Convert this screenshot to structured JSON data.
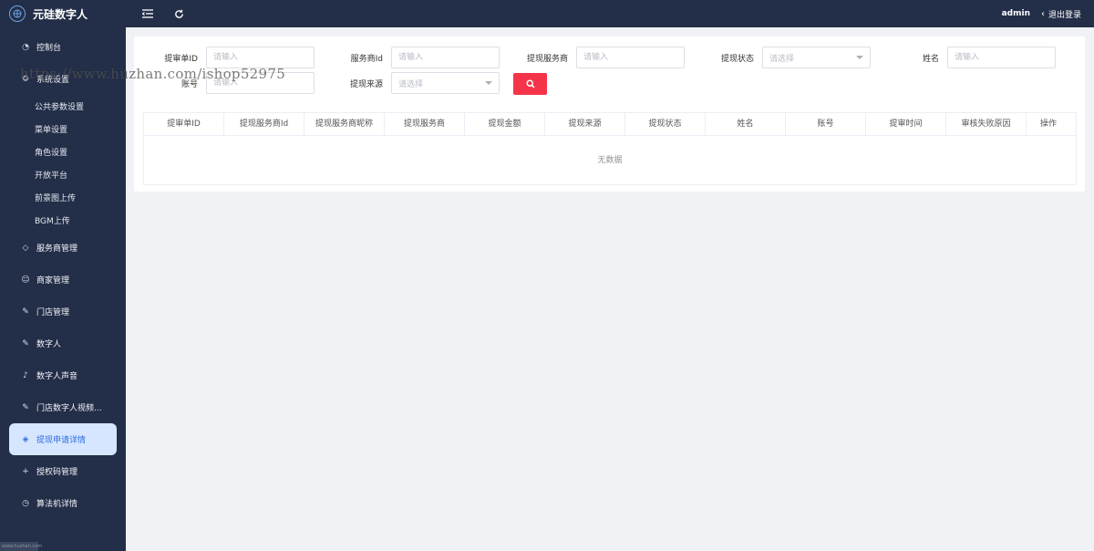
{
  "brand": {
    "name": "元硅数字人",
    "logo_icon": "brain-circuit-logo"
  },
  "topbar": {
    "user": "admin",
    "logout_label": "退出登录"
  },
  "sidebar": {
    "items": [
      {
        "label": "控制台",
        "icon": "dashboard-icon"
      },
      {
        "label": "系统设置",
        "icon": "gear-icon"
      },
      {
        "label": "公共参数设置",
        "sub": true
      },
      {
        "label": "菜单设置",
        "sub": true
      },
      {
        "label": "角色设置",
        "sub": true
      },
      {
        "label": "开放平台",
        "sub": true
      },
      {
        "label": "前景图上传",
        "sub": true
      },
      {
        "label": "BGM上传",
        "sub": true
      },
      {
        "label": "服务商管理",
        "icon": "diamond-icon"
      },
      {
        "label": "商家管理",
        "icon": "smile-icon"
      },
      {
        "label": "门店管理",
        "icon": "edit-square-icon"
      },
      {
        "label": "数字人",
        "icon": "edit-square-icon"
      },
      {
        "label": "数字人声音",
        "icon": "music-note-icon"
      },
      {
        "label": "门店数字人视频...",
        "icon": "edit-square-icon"
      },
      {
        "label": "提现申请详情",
        "icon": "stack-icon",
        "active": true
      },
      {
        "label": "授权码管理",
        "icon": "plus-icon"
      },
      {
        "label": "算法机详情",
        "icon": "clock-icon"
      }
    ],
    "footer": "www.huzhan.com"
  },
  "filters": {
    "withdraw_id": {
      "label": "提审单ID",
      "placeholder": "请输入"
    },
    "provider_id": {
      "label": "服务商Id",
      "placeholder": "请输入"
    },
    "provider": {
      "label": "提现服务商",
      "placeholder": "请输入"
    },
    "status": {
      "label": "提现状态",
      "placeholder": "请选择"
    },
    "name": {
      "label": "姓名",
      "placeholder": "请输入"
    },
    "account": {
      "label": "账号",
      "placeholder": "请输入"
    },
    "source": {
      "label": "提现来源",
      "placeholder": "请选择"
    },
    "search_icon": "search-icon"
  },
  "table": {
    "columns": [
      "提审单ID",
      "提现服务商Id",
      "提现服务商昵称",
      "提现服务商",
      "提现金额",
      "提现来源",
      "提现状态",
      "姓名",
      "账号",
      "提审时间",
      "审核失败原因",
      "操作"
    ],
    "empty_text": "无数据"
  },
  "watermark": "https://www.huzhan.com/ishop52975",
  "colors": {
    "sidebar_bg": "#232e48",
    "active_bg": "#d6e6ff",
    "active_text": "#2d6cdf",
    "search_button": "#f5344a"
  }
}
